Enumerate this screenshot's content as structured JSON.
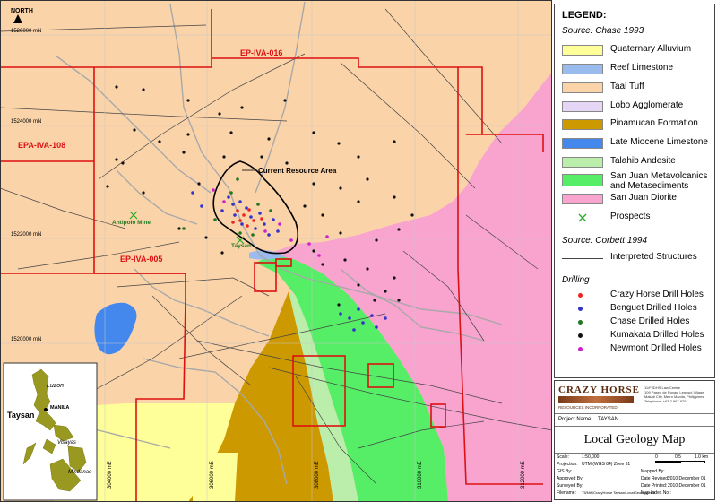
{
  "north": "NORTH",
  "coords": {
    "n1526": "1526000 mN",
    "n1524": "1524000 mN",
    "n1522": "1522000 mN",
    "n1520": "1520000 mN",
    "e304": "304000 mE",
    "e306": "306000 mE",
    "e308": "308000 mE",
    "e310": "310000 mE",
    "e312": "312000 mE"
  },
  "tenements": {
    "ep016": "EP-IVA-016",
    "epa108": "EPA-IVA-108",
    "ep005": "EP-IVA-005"
  },
  "labels": {
    "resource": "Current Resource Area",
    "antipolo": "Antipolo Mine",
    "taysan_map": "Taysan"
  },
  "inset": {
    "luzon": "Luzon",
    "manila": "MANILA",
    "taysan": "Taysan",
    "visayas": "Visayas",
    "mindanao": "Mindanao"
  },
  "legend": {
    "title": "LEGEND:",
    "source1": "Source: Chase 1993",
    "units": [
      {
        "label": "Quaternary Alluvium",
        "color": "#ffff99"
      },
      {
        "label": "Reef Limestone",
        "color": "#99bbee"
      },
      {
        "label": "Taal Tuff",
        "color": "#fbd3a9"
      },
      {
        "label": "Lobo Agglomerate",
        "color": "#e6d6f5"
      },
      {
        "label": "Pinamucan Formation",
        "color": "#cc9900"
      },
      {
        "label": "Late Miocene Limestone",
        "color": "#4488ee"
      },
      {
        "label": "Talahib Andesite",
        "color": "#bbeeaa"
      },
      {
        "label": "San Juan Metavolcanics",
        "label2": "and Metasediments",
        "color": "#55ee66"
      },
      {
        "label": "San Juan Diorite",
        "color": "#f9a3cf"
      }
    ],
    "prospects": "Prospects",
    "source2": "Source: Corbett 1994",
    "structures": "Interpreted Structures",
    "drilling_title": "Drilling",
    "drilling": [
      {
        "label": "Crazy Horse Drill Holes",
        "color": "#ee2222"
      },
      {
        "label": "Benguet Drilled Holes",
        "color": "#3333cc"
      },
      {
        "label": "Chase Drilled Holes",
        "color": "#227722"
      },
      {
        "label": "Kumakata Drilled Holes",
        "color": "#111111"
      },
      {
        "label": "Newmont Drilled Holes",
        "color": "#cc22cc"
      }
    ]
  },
  "titleblock": {
    "company": "CRAZY HORSE",
    "company_sub": "RESOURCES INCORPORATED",
    "address1": "11/F IDHS Law Centre",
    "address2": "109 Paseo de Roxas, Legaspi Village",
    "address3": "Makati City, Metro Manila, Philippines",
    "address4": "Telephone: +63 2 867 8701",
    "project_label": "Project Name:",
    "project": "TAYSAN",
    "map_title": "Local Geology Map",
    "scale_label": "Scale:",
    "scale": "1:50,000",
    "projection_label": "Projection:",
    "projection": "UTM (WGS 84) Zone 51",
    "gis_label": "GIS By:",
    "approved_label": "Approved By:",
    "surveyed_label": "Surveyed By:",
    "filename_label": "Filename:",
    "filename": "T5/Nth/CrazyHorse Taysan/LocalGeology.mxd",
    "mapped_label": "Mapped By:",
    "revised_label": "Date Revised:",
    "revised": "2010 December 01",
    "printed_label": "Date Printed:",
    "printed": "2010 December 01",
    "mapindex_label": "Map Index No.:",
    "scale0": "0",
    "scale05": "0.5",
    "scale1": "1.0 km"
  }
}
